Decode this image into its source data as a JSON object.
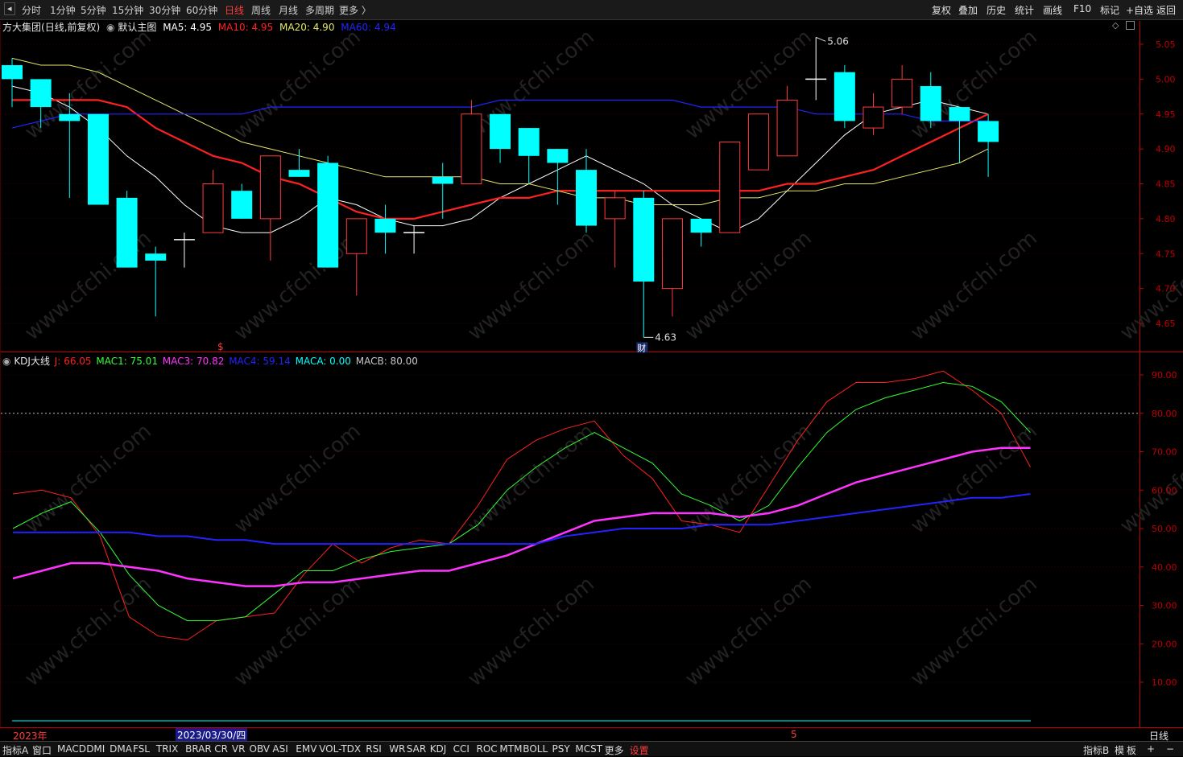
{
  "colors": {
    "up": "#ff3b3b",
    "down": "#00ffff",
    "ma5": "#ffffff",
    "ma10": "#ff2020",
    "ma20": "#e6e66a",
    "ma60": "#2323ff",
    "j": "#ff2020",
    "mac1": "#33ff33",
    "mac3": "#ff33ff",
    "mac4": "#2323ff",
    "maca": "#00ffff",
    "macb": "#c8c8c8",
    "axis": "#c00000"
  },
  "toolbar": {
    "back_icon": "◂",
    "periods": [
      "分时",
      "1分钟",
      "5分钟",
      "15分钟",
      "30分钟",
      "60分钟",
      "日线",
      "周线",
      "月线",
      "多周期",
      "更多 〉"
    ],
    "active_period": "日线",
    "right": [
      "复权",
      "叠加",
      "历史",
      "统计",
      "画线",
      "F10",
      "标记",
      "+自选",
      "返回"
    ]
  },
  "main_legend": {
    "stock": "方大集团",
    "mode": "(日线,前复权)",
    "template": "默认主图",
    "ma5": "MA5: 4.95",
    "ma10": "MA10: 4.95",
    "ma20": "MA20: 4.90",
    "ma60": "MA60: 4.94"
  },
  "sub_legend": {
    "name": "KDJ大线",
    "j": "J: 66.05",
    "mac1": "MAC1: 75.01",
    "mac3": "MAC3: 70.82",
    "mac4": "MAC4: 59.14",
    "maca": "MACA: 0.00",
    "macb": "MACB: 80.00"
  },
  "annotations": {
    "high": "5.06",
    "low": "4.63",
    "low_badge": "财",
    "dollar": "$"
  },
  "axis_bottom": {
    "year": "2023年",
    "cursor_date": "2023/03/30/四",
    "month": "5",
    "period": "日线"
  },
  "watermark": "www.cfchi.com",
  "bottom_tabs": {
    "left": "指标A",
    "items": [
      "窗口",
      "MACD",
      "DMI",
      "DMA",
      "FSL",
      "TRIX",
      "BRAR",
      "CR",
      "VR",
      "OBV",
      "ASI",
      "EMV",
      "VOL-TDX",
      "RSI",
      "WR",
      "SAR",
      "KDJ",
      "CCI",
      "ROC",
      "MTM",
      "BOLL",
      "PSY",
      "MCST",
      "更多"
    ],
    "settings": "设置",
    "right": [
      "指标B",
      "模",
      "板",
      "+",
      "−"
    ]
  },
  "chart_data": [
    {
      "type": "candlestick",
      "title": "方大集团 (日线,前复权)",
      "ylim": [
        4.62,
        5.08
      ],
      "yticks": [
        4.65,
        4.7,
        4.75,
        4.8,
        4.85,
        4.9,
        4.95,
        5.0,
        5.05
      ],
      "candles": [
        {
          "o": 5.02,
          "h": 5.03,
          "l": 4.96,
          "c": 5.0
        },
        {
          "o": 5.0,
          "h": 5.0,
          "l": 4.93,
          "c": 4.96
        },
        {
          "o": 4.95,
          "h": 4.98,
          "l": 4.83,
          "c": 4.94
        },
        {
          "o": 4.95,
          "h": 4.95,
          "l": 4.82,
          "c": 4.82
        },
        {
          "o": 4.83,
          "h": 4.84,
          "l": 4.73,
          "c": 4.73
        },
        {
          "o": 4.75,
          "h": 4.76,
          "l": 4.66,
          "c": 4.74
        },
        {
          "o": 4.77,
          "h": 4.78,
          "l": 4.73,
          "c": 4.77
        },
        {
          "o": 4.78,
          "h": 4.87,
          "l": 4.78,
          "c": 4.85
        },
        {
          "o": 4.84,
          "h": 4.85,
          "l": 4.8,
          "c": 4.8
        },
        {
          "o": 4.8,
          "h": 4.89,
          "l": 4.74,
          "c": 4.89
        },
        {
          "o": 4.87,
          "h": 4.9,
          "l": 4.86,
          "c": 4.86
        },
        {
          "o": 4.88,
          "h": 4.89,
          "l": 4.73,
          "c": 4.73
        },
        {
          "o": 4.75,
          "h": 4.8,
          "l": 4.69,
          "c": 4.8
        },
        {
          "o": 4.8,
          "h": 4.82,
          "l": 4.75,
          "c": 4.78
        },
        {
          "o": 4.78,
          "h": 4.79,
          "l": 4.75,
          "c": 4.78
        },
        {
          "o": 4.86,
          "h": 4.88,
          "l": 4.8,
          "c": 4.85
        },
        {
          "o": 4.85,
          "h": 4.97,
          "l": 4.85,
          "c": 4.95
        },
        {
          "o": 4.95,
          "h": 4.95,
          "l": 4.88,
          "c": 4.9
        },
        {
          "o": 4.93,
          "h": 4.93,
          "l": 4.85,
          "c": 4.89
        },
        {
          "o": 4.9,
          "h": 4.9,
          "l": 4.82,
          "c": 4.88
        },
        {
          "o": 4.87,
          "h": 4.9,
          "l": 4.78,
          "c": 4.79
        },
        {
          "o": 4.8,
          "h": 4.84,
          "l": 4.73,
          "c": 4.83
        },
        {
          "o": 4.83,
          "h": 4.84,
          "l": 4.63,
          "c": 4.71
        },
        {
          "o": 4.7,
          "h": 4.8,
          "l": 4.66,
          "c": 4.8
        },
        {
          "o": 4.8,
          "h": 4.8,
          "l": 4.76,
          "c": 4.78
        },
        {
          "o": 4.78,
          "h": 4.91,
          "l": 4.78,
          "c": 4.91
        },
        {
          "o": 4.87,
          "h": 4.95,
          "l": 4.87,
          "c": 4.95
        },
        {
          "o": 4.89,
          "h": 4.99,
          "l": 4.89,
          "c": 4.97
        },
        {
          "o": 5.0,
          "h": 5.06,
          "l": 4.97,
          "c": 5.0
        },
        {
          "o": 5.01,
          "h": 5.02,
          "l": 4.93,
          "c": 4.94
        },
        {
          "o": 4.93,
          "h": 4.98,
          "l": 4.92,
          "c": 4.96
        },
        {
          "o": 4.96,
          "h": 5.02,
          "l": 4.95,
          "c": 5.0
        },
        {
          "o": 4.99,
          "h": 5.01,
          "l": 4.93,
          "c": 4.94
        },
        {
          "o": 4.96,
          "h": 4.96,
          "l": 4.88,
          "c": 4.94
        },
        {
          "o": 4.94,
          "h": 4.95,
          "l": 4.86,
          "c": 4.91
        }
      ],
      "series": [
        {
          "name": "MA5",
          "values": [
            4.99,
            4.98,
            4.96,
            4.93,
            4.89,
            4.86,
            4.82,
            4.79,
            4.78,
            4.78,
            4.8,
            4.83,
            4.82,
            4.8,
            4.79,
            4.79,
            4.8,
            4.83,
            4.85,
            4.87,
            4.89,
            4.87,
            4.85,
            4.82,
            4.8,
            4.78,
            4.8,
            4.84,
            4.88,
            4.92,
            4.95,
            4.96,
            4.97,
            4.96,
            4.95
          ]
        },
        {
          "name": "MA10",
          "values": [
            4.97,
            4.97,
            4.97,
            4.97,
            4.96,
            4.93,
            4.91,
            4.89,
            4.88,
            4.86,
            4.85,
            4.83,
            4.81,
            4.8,
            4.8,
            4.81,
            4.82,
            4.83,
            4.83,
            4.84,
            4.84,
            4.84,
            4.84,
            4.84,
            4.84,
            4.84,
            4.84,
            4.85,
            4.85,
            4.86,
            4.87,
            4.89,
            4.91,
            4.93,
            4.95
          ]
        },
        {
          "name": "MA20",
          "values": [
            5.03,
            5.02,
            5.02,
            5.01,
            4.99,
            4.97,
            4.95,
            4.93,
            4.91,
            4.9,
            4.89,
            4.88,
            4.87,
            4.86,
            4.86,
            4.86,
            4.86,
            4.85,
            4.85,
            4.84,
            4.83,
            4.83,
            4.82,
            4.82,
            4.82,
            4.83,
            4.83,
            4.84,
            4.84,
            4.85,
            4.85,
            4.86,
            4.87,
            4.88,
            4.9
          ]
        },
        {
          "name": "MA60",
          "values": [
            4.93,
            4.94,
            4.95,
            4.95,
            4.95,
            4.95,
            4.95,
            4.95,
            4.95,
            4.96,
            4.96,
            4.96,
            4.96,
            4.96,
            4.96,
            4.96,
            4.96,
            4.97,
            4.97,
            4.97,
            4.97,
            4.97,
            4.97,
            4.97,
            4.96,
            4.96,
            4.96,
            4.96,
            4.95,
            4.95,
            4.95,
            4.95,
            4.94,
            4.94,
            4.94
          ]
        }
      ],
      "annotations": [
        {
          "label": "5.06",
          "index": 28,
          "value": 5.06
        },
        {
          "label": "4.63",
          "index": 22,
          "value": 4.63
        }
      ]
    },
    {
      "type": "line",
      "title": "KDJ大线",
      "ylim": [
        0,
        100
      ],
      "yticks": [
        10,
        20,
        30,
        40,
        50,
        60,
        70,
        80,
        90
      ],
      "reference_lines": [
        80
      ],
      "series": [
        {
          "name": "J",
          "values": [
            59,
            60,
            58,
            48,
            27,
            22,
            21,
            26,
            27,
            28,
            38,
            46,
            41,
            45,
            47,
            46,
            56,
            68,
            73,
            76,
            78,
            69,
            63,
            52,
            51,
            49,
            61,
            73,
            83,
            88,
            88,
            89,
            91,
            86,
            80,
            66
          ]
        },
        {
          "name": "MAC1",
          "values": [
            50,
            54,
            57,
            49,
            38,
            30,
            26,
            26,
            27,
            33,
            39,
            39,
            42,
            44,
            45,
            46,
            51,
            60,
            66,
            71,
            75,
            71,
            67,
            59,
            56,
            52,
            56,
            66,
            75,
            81,
            84,
            86,
            88,
            87,
            83,
            75
          ]
        },
        {
          "name": "MAC3",
          "values": [
            37,
            39,
            41,
            41,
            40,
            39,
            37,
            36,
            35,
            35,
            36,
            36,
            37,
            38,
            39,
            39,
            41,
            43,
            46,
            49,
            52,
            53,
            54,
            54,
            54,
            53,
            54,
            56,
            59,
            62,
            64,
            66,
            68,
            70,
            71,
            71
          ]
        },
        {
          "name": "MAC4",
          "values": [
            49,
            49,
            49,
            49,
            49,
            48,
            48,
            47,
            47,
            46,
            46,
            46,
            46,
            46,
            46,
            46,
            46,
            46,
            46,
            48,
            49,
            50,
            50,
            50,
            51,
            51,
            51,
            52,
            53,
            54,
            55,
            56,
            57,
            58,
            58,
            59
          ]
        },
        {
          "name": "MACA",
          "values": [
            0
          ]
        },
        {
          "name": "MACB",
          "values": [
            80
          ]
        }
      ]
    }
  ]
}
